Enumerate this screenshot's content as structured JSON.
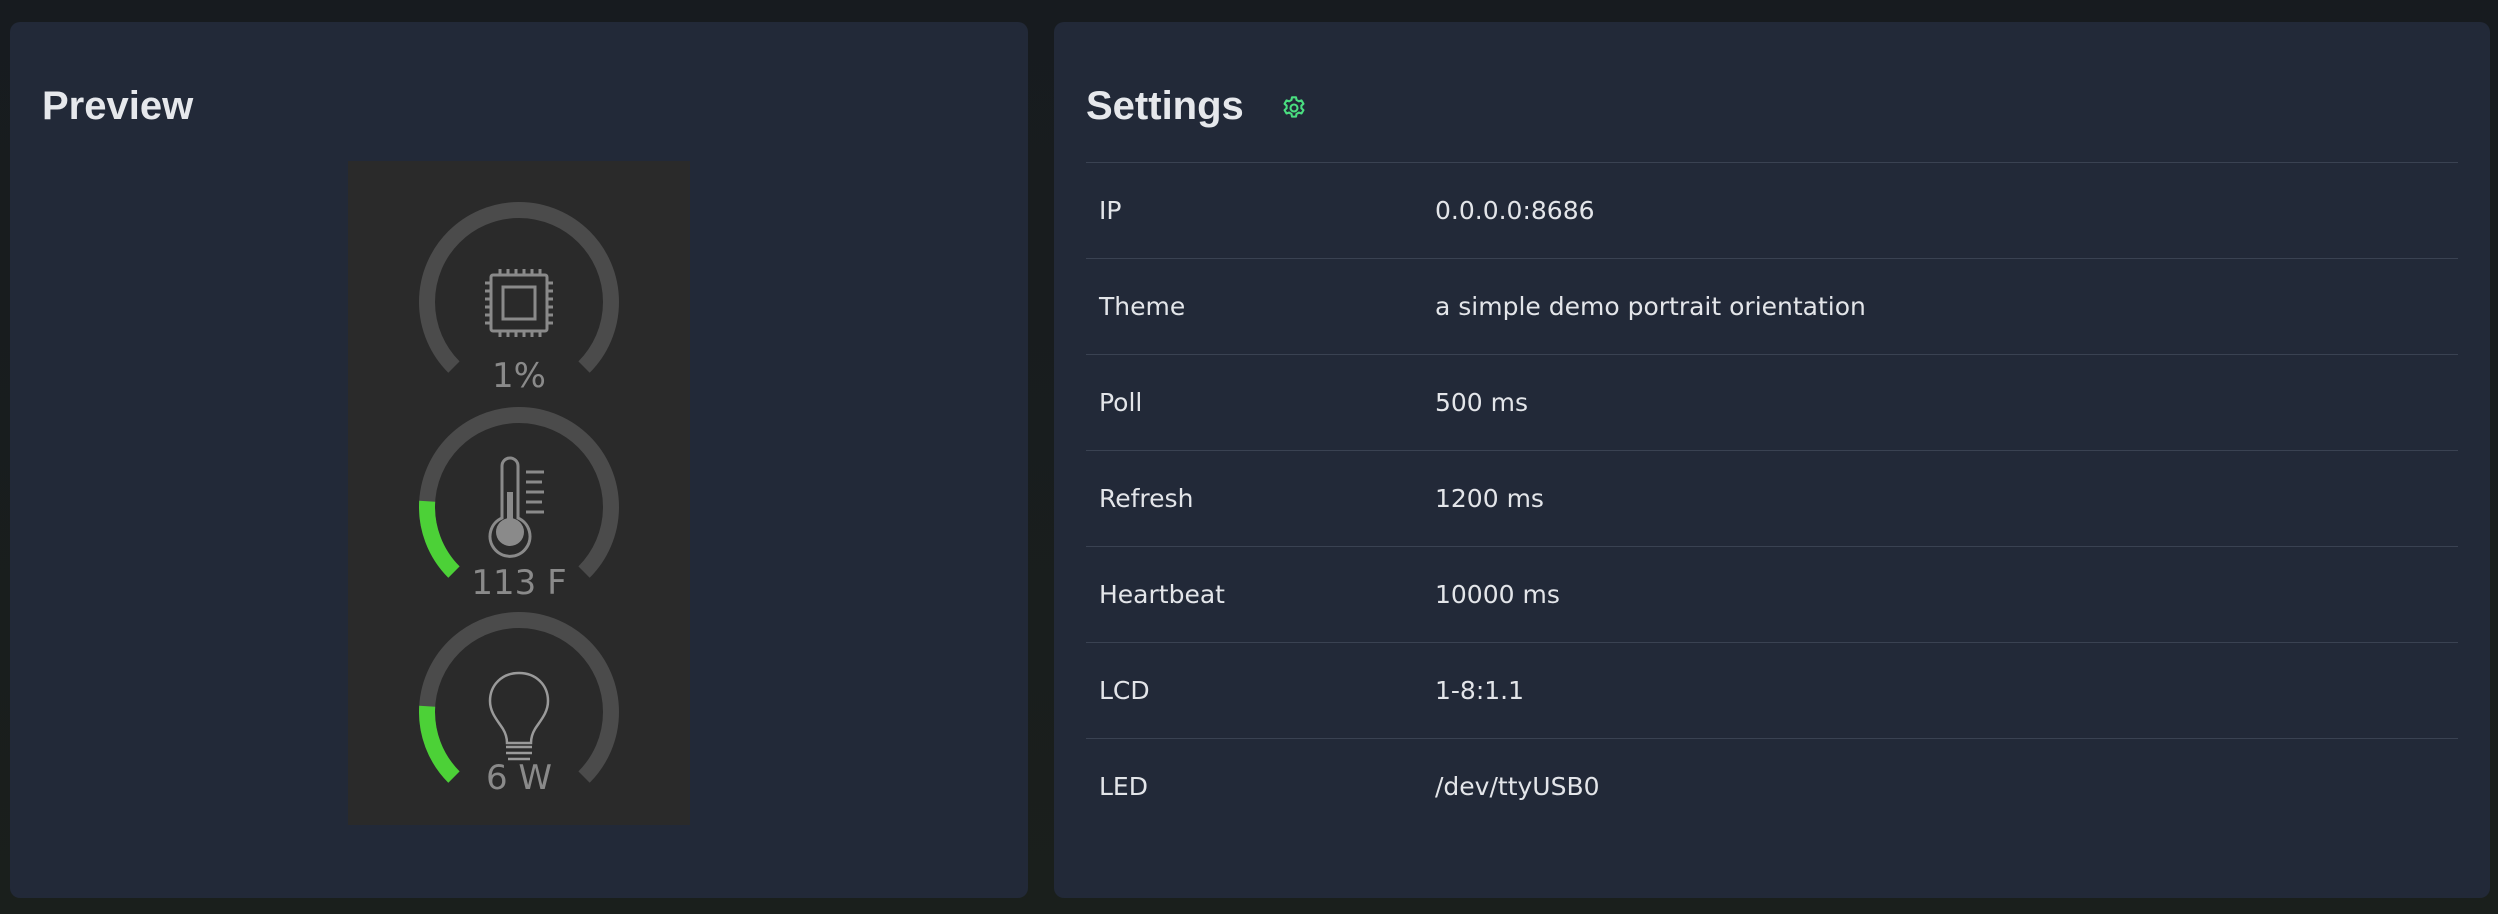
{
  "preview": {
    "title": "Preview",
    "gauges": [
      {
        "name": "cpu",
        "icon": "cpu-icon",
        "value_label": "1%",
        "level": 0.01
      },
      {
        "name": "temperature",
        "icon": "thermometer-icon",
        "value_label": "113 F",
        "level": 0.18
      },
      {
        "name": "power",
        "icon": "lightbulb-icon",
        "value_label": "6 W",
        "level": 0.18
      }
    ],
    "colors": {
      "track": "#4b4b4b",
      "fill": "#4cd137",
      "lcd_background": "#2a2a2a"
    }
  },
  "settings": {
    "title": "Settings",
    "icon": "gear-icon",
    "rows": [
      {
        "key": "IP",
        "value": "0.0.0.0:8686"
      },
      {
        "key": "Theme",
        "value": "a simple demo portrait orientation"
      },
      {
        "key": "Poll",
        "value": "500 ms"
      },
      {
        "key": "Refresh",
        "value": "1200 ms"
      },
      {
        "key": "Heartbeat",
        "value": "10000 ms"
      },
      {
        "key": "LCD",
        "value": "1-8:1.1"
      },
      {
        "key": "LED",
        "value": "/dev/ttyUSB0"
      }
    ]
  },
  "theme_colors": {
    "page_background": "#181c1f",
    "panel_background": "#222938",
    "accent": "#4ade80"
  }
}
